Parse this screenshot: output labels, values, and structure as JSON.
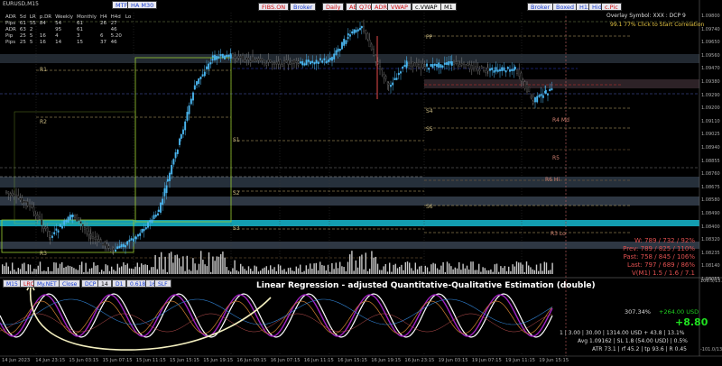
{
  "window": {
    "symbol_label": "EURUSD,M15"
  },
  "toolbar_top": {
    "mtf": "MTF",
    "ha": "HA M30",
    "fibs": "FIBS.ON",
    "broker": "Broker",
    "daily": "Daily",
    "ae": "AE",
    "q70": "Q70",
    "adr": "ADR",
    "vwap": "VWAP",
    "cvwap": "c.VWAP",
    "m1": "M1",
    "broker2": "Broker",
    "boxed": "Boxed",
    "h12": "H12",
    "hido": "HidO",
    "epic": "c.Pic"
  },
  "overlay": {
    "line1": "Overlay Symbol: XXX : DCP 9",
    "line2": "99.1 77% Click to Start Correlation"
  },
  "stats": {
    "headers": [
      "ADR",
      "5d",
      "LR",
      "p.DR",
      "Weekly",
      "Monthly",
      "H4",
      "H4d",
      "Lo"
    ],
    "rows": [
      [
        "Pips",
        "61",
        "55",
        "84",
        "54",
        "61",
        "26",
        "27"
      ],
      [
        "ADR",
        "63",
        "2",
        "",
        "95",
        "61",
        "",
        "46"
      ],
      [
        "Pip",
        "25",
        "5",
        "16",
        "4",
        "3",
        "6",
        "5.20"
      ],
      [
        "Pips",
        "25",
        "5",
        "16",
        "14",
        "15",
        "37",
        "46"
      ]
    ]
  },
  "price_axis": [
    "1.09800",
    "1.09740",
    "1.09650",
    "1.09560",
    "1.09470",
    "1.09380",
    "1.09290",
    "1.09200",
    "1.09110",
    "1.09025",
    "1.08940",
    "1.08855",
    "1.08760",
    "1.08675",
    "1.08580",
    "1.08490",
    "1.08400",
    "1.08320",
    "1.08235",
    "1.08140",
    "1.08055"
  ],
  "osc_axis": [
    "106.5/13.7",
    "-101.0/13.5"
  ],
  "bottom_buttons": [
    "M15",
    "LRQ",
    "My.NET",
    "Close",
    "DCP",
    "14",
    "D1",
    "0.618",
    "16",
    "SLF"
  ],
  "osc_title": "Linear Regression - adjusted Quantitative-Qualitative Estimation (double)",
  "time_axis": [
    "14 Jun 2023",
    "14 Jun 23:15",
    "15 Jun 03:15",
    "15 Jun 07:15",
    "15 Jun 11:15",
    "15 Jun 15:15",
    "15 Jun 19:15",
    "16 Jun 00:15",
    "16 Jun 07:15",
    "16 Jun 11:15",
    "16 Jun 15:15",
    "16 Jun 19:15",
    "16 Jun 23:15",
    "19 Jun 03:15",
    "19 Jun 07:15",
    "19 Jun 11:15",
    "19 Jun 15:15"
  ],
  "right_stats": [
    "W: 789 / 732 / 92%",
    "Prev: 789 / 825 / 110%",
    "Past: 758 / 845 / 106%",
    "Last: 797 / 689 / 86%",
    "V(M1) 1.5 / 1.6 / 7.1"
  ],
  "bottom_info": {
    "pct": "307.34%",
    "gain": "+264.00 USD",
    "big": "+8.80",
    "line1": "1  |  3.00  |  30.00  |  1314.00 USD + 43.8  |  13.1%",
    "line2": "Avg 1.09162  |  SL 1.8 (54.00 USD)  |  0.5%",
    "line3": "ATR 73.1  |  rf 45.2  |  tp 93.6  |  R 0.45"
  },
  "level_labels": [
    "S1",
    "S2",
    "S3",
    "R1",
    "R2",
    "R3",
    "PP",
    "S5",
    "S4",
    "S6",
    "R3 Lo",
    "R4 Md",
    "R5",
    "R6 Hi"
  ],
  "colors": {
    "bg": "#000000",
    "bull": "#4ab6f0",
    "bear": "#111111",
    "box": "#9acd32",
    "band": "#2e3a47",
    "cyan": "#18d0e8",
    "red": "#d82020",
    "purple": "#a020c0"
  }
}
